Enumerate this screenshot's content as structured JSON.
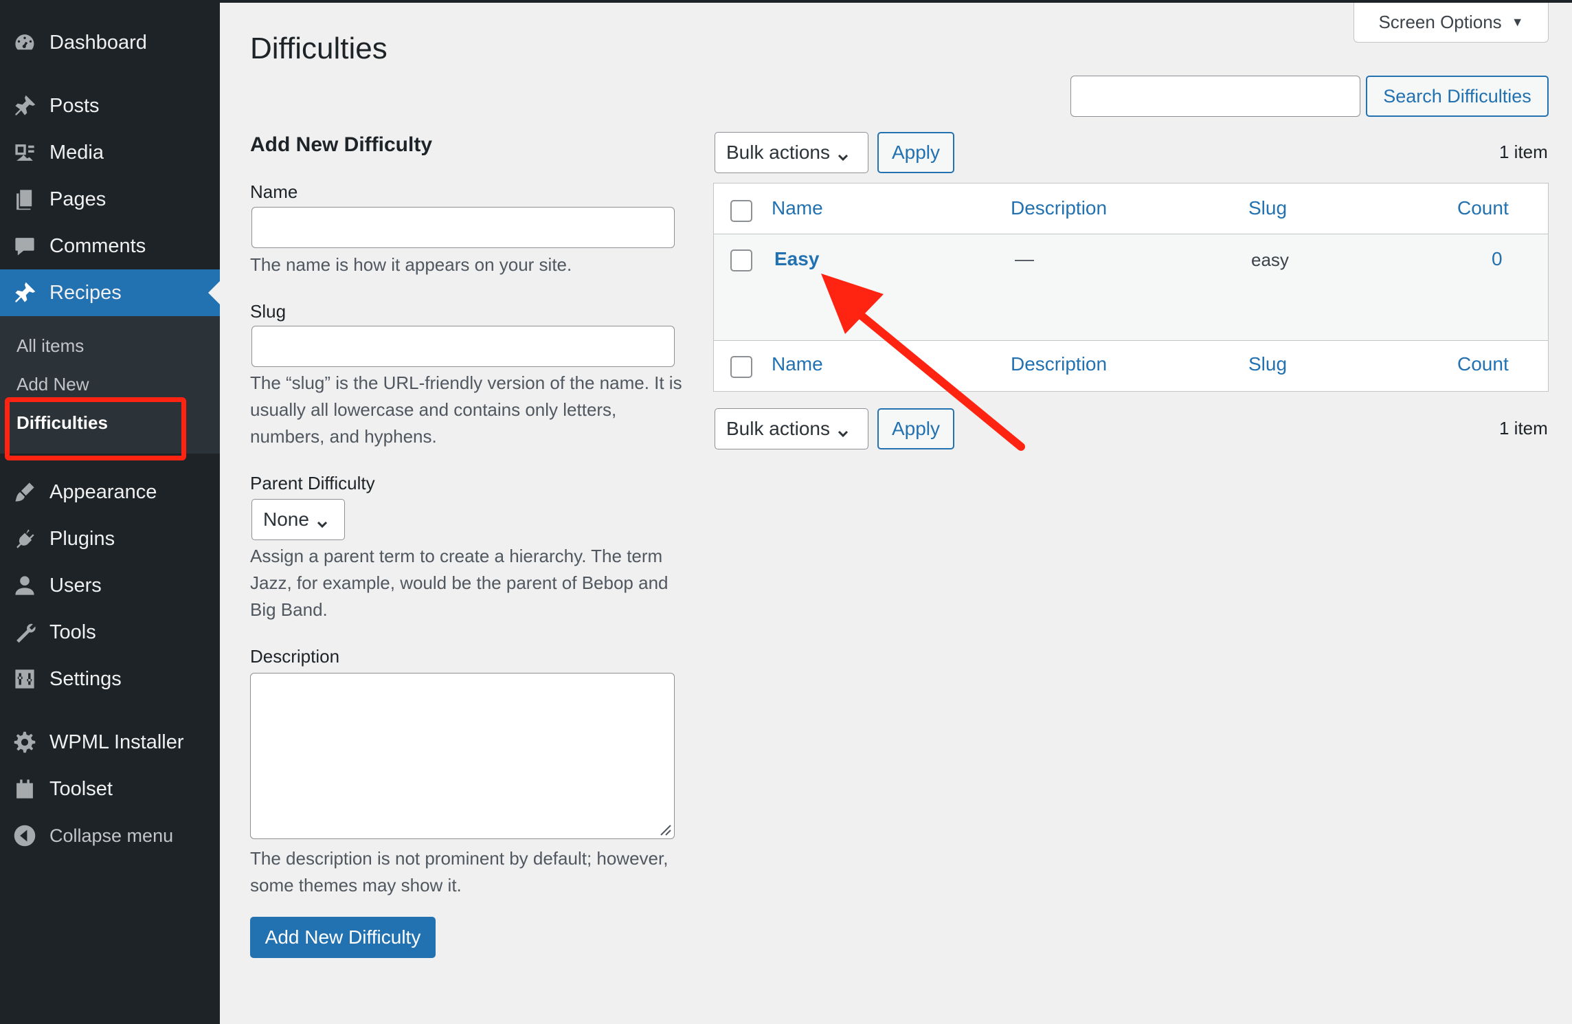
{
  "sidebar": {
    "items": [
      {
        "label": "Dashboard",
        "icon": "dashboard-icon"
      },
      {
        "label": "Posts",
        "icon": "pin-icon"
      },
      {
        "label": "Media",
        "icon": "media-icon"
      },
      {
        "label": "Pages",
        "icon": "pages-icon"
      },
      {
        "label": "Comments",
        "icon": "comment-icon"
      },
      {
        "label": "Recipes",
        "icon": "pin-icon"
      },
      {
        "label": "Appearance",
        "icon": "brush-icon"
      },
      {
        "label": "Plugins",
        "icon": "plug-icon"
      },
      {
        "label": "Users",
        "icon": "user-icon"
      },
      {
        "label": "Tools",
        "icon": "wrench-icon"
      },
      {
        "label": "Settings",
        "icon": "sliders-icon"
      },
      {
        "label": "WPML Installer",
        "icon": "gear-icon"
      },
      {
        "label": "Toolset",
        "icon": "toolset-icon"
      }
    ],
    "submenu": [
      "All items",
      "Add New",
      "Difficulties"
    ],
    "collapse_label": "Collapse menu",
    "active_item": "Recipes",
    "active_subitem": "Difficulties"
  },
  "header": {
    "title": "Difficulties",
    "screen_options": "Screen Options"
  },
  "search": {
    "value": "",
    "button": "Search Difficulties"
  },
  "form": {
    "heading": "Add New Difficulty",
    "name_label": "Name",
    "name_value": "",
    "name_help": "The name is how it appears on your site.",
    "slug_label": "Slug",
    "slug_value": "",
    "slug_help": "The “slug” is the URL-friendly version of the name. It is usually all lowercase and contains only letters, numbers, and hyphens.",
    "parent_label": "Parent Difficulty",
    "parent_value": "None",
    "parent_help": "Assign a parent term to create a hierarchy. The term Jazz, for example, would be the parent of Bebop and Big Band.",
    "description_label": "Description",
    "description_value": "",
    "description_help": "The description is not prominent by default; however, some themes may show it.",
    "submit": "Add New Difficulty"
  },
  "table": {
    "bulk_actions": "Bulk actions",
    "apply": "Apply",
    "item_count": "1 item",
    "columns": [
      "Name",
      "Description",
      "Slug",
      "Count"
    ],
    "rows": [
      {
        "name": "Easy",
        "description": "—",
        "slug": "easy",
        "count": "0"
      }
    ]
  },
  "colors": {
    "sidebar_bg": "#1d2327",
    "accent": "#2271b1",
    "annotation": "#ff2412"
  }
}
